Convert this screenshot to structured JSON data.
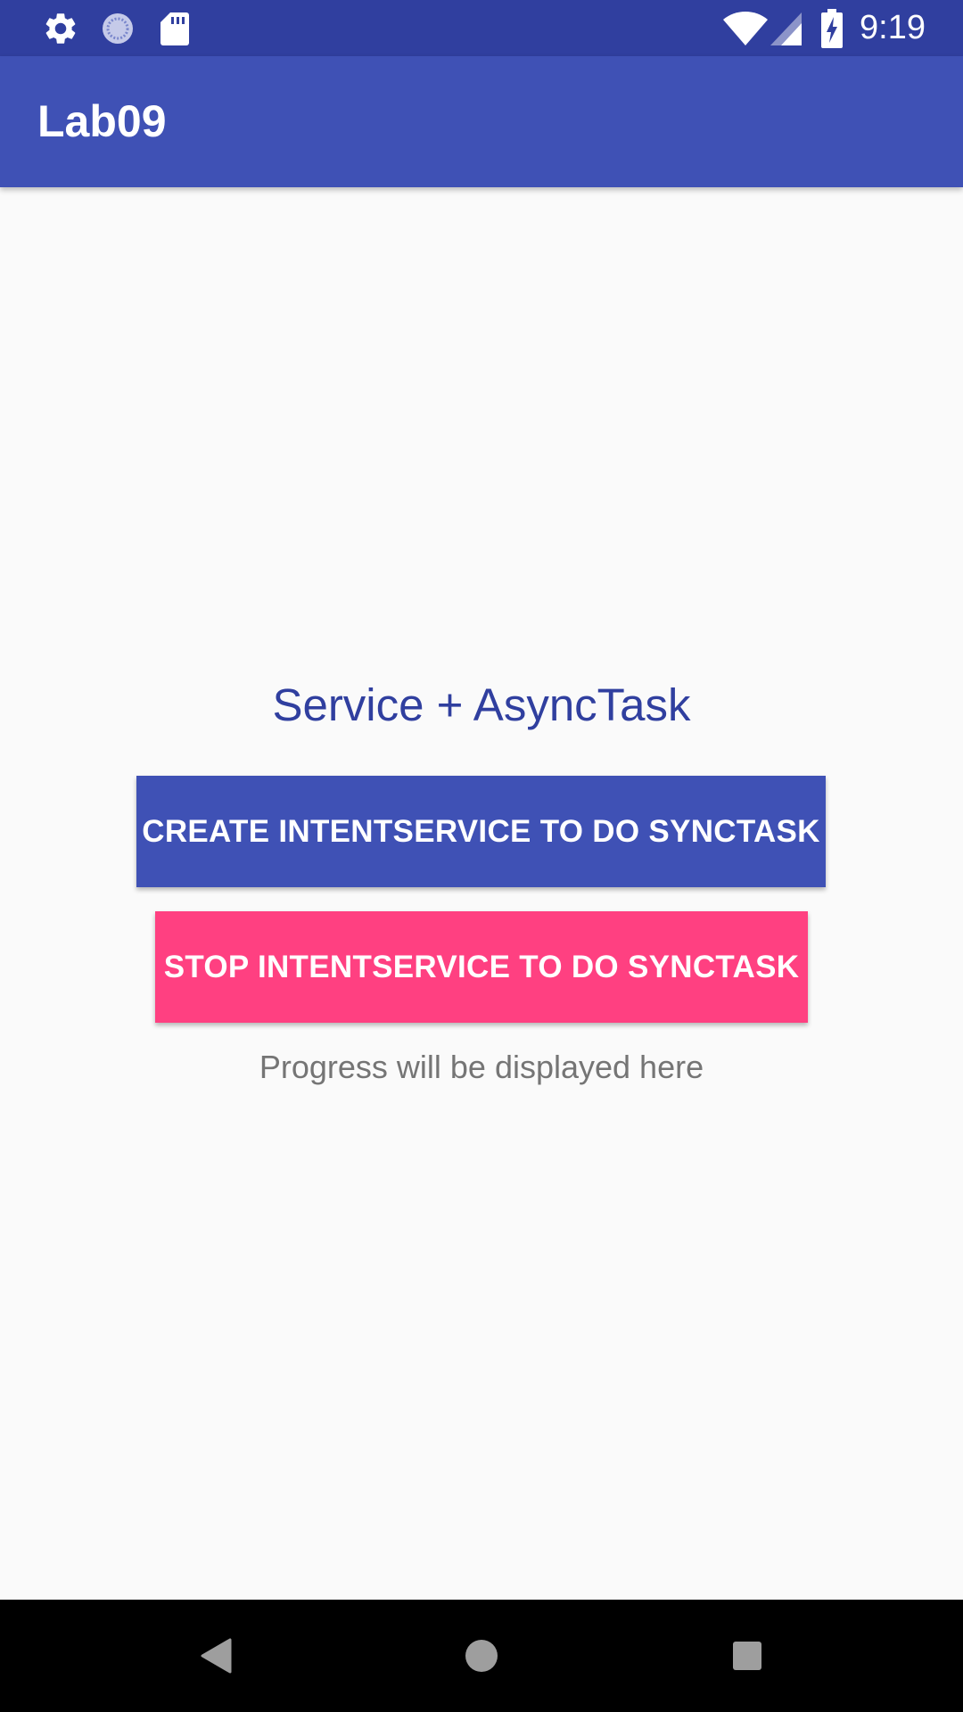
{
  "status_bar": {
    "time": "9:19",
    "icons_left": [
      "settings-gear-icon",
      "loading-circle-icon",
      "sd-card-icon"
    ],
    "icons_right": [
      "wifi-icon",
      "cell-signal-icon",
      "battery-charging-icon"
    ]
  },
  "app_bar": {
    "title": "Lab09"
  },
  "main": {
    "heading": "Service + AsyncTask",
    "create_button_label": "CREATE INTENTSERVICE TO DO SYNCTASK",
    "stop_button_label": "STOP INTENTSERVICE TO DO SYNCTASK",
    "progress_text": "Progress will be displayed here"
  },
  "nav_bar": {
    "buttons": [
      "back-icon",
      "home-icon",
      "recents-icon"
    ]
  },
  "colors": {
    "status_bar": "#303f9f",
    "primary": "#3f51b5",
    "accent": "#ff4081",
    "background": "#fafafa",
    "secondary_text": "#757575"
  }
}
